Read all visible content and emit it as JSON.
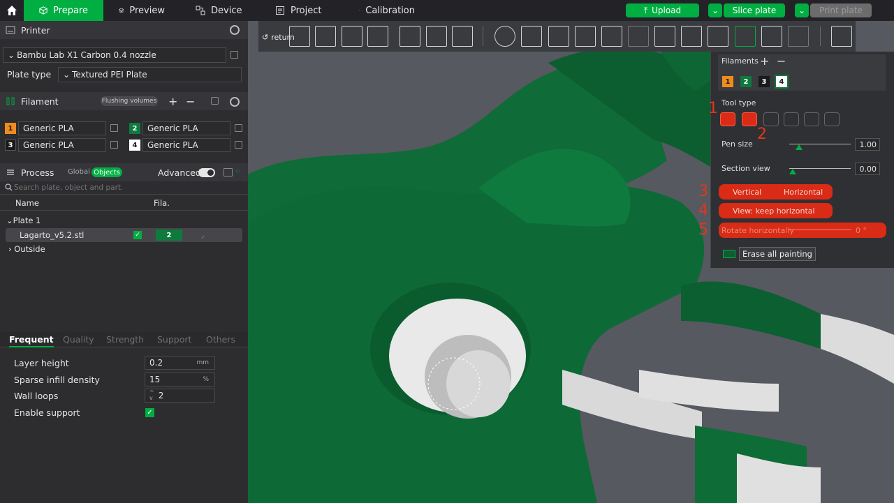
{
  "topbar": {
    "tabs": [
      {
        "label": "Prepare",
        "icon": "cube-icon"
      },
      {
        "label": "Preview",
        "icon": "layers-icon"
      },
      {
        "label": "Device",
        "icon": "device-icon"
      },
      {
        "label": "Project",
        "icon": "project-icon"
      },
      {
        "label": "Calibration",
        "icon": "calibration-icon"
      }
    ],
    "upload": "Upload",
    "slice": "Slice plate",
    "print": "Print plate"
  },
  "printer": {
    "title": "Printer",
    "name": "Bambu Lab X1 Carbon 0.4 nozzle",
    "plate_type_label": "Plate type",
    "plate_type": "Textured PEI Plate"
  },
  "filament": {
    "title": "Filament",
    "flushing": "Flushing volumes",
    "items": [
      {
        "num": "1",
        "name": "Generic PLA",
        "color": "#f08c1e"
      },
      {
        "num": "2",
        "name": "Generic PLA",
        "color": "#0e7a3e"
      },
      {
        "num": "3",
        "name": "Generic PLA",
        "color": "#1a1a1a"
      },
      {
        "num": "4",
        "name": "Generic PLA",
        "color": "#ffffff"
      }
    ]
  },
  "process": {
    "title": "Process",
    "global": "Global",
    "objects": "Objects",
    "advanced": "Advanced",
    "search_placeholder": "Search plate, object and part."
  },
  "objects": {
    "col_name": "Name",
    "col_fila": "Fila.",
    "plate": "Plate 1",
    "object": "Lagarto_v5.2.stl",
    "object_fila": "2",
    "outside": "Outside"
  },
  "tabs2": [
    "Frequent",
    "Quality",
    "Strength",
    "Support",
    "Others"
  ],
  "settings": [
    {
      "label": "Layer height",
      "value": "0.2",
      "unit": "mm"
    },
    {
      "label": "Sparse infill density",
      "value": "15",
      "unit": "%"
    },
    {
      "label": "Wall loops",
      "value": "2",
      "unit": ""
    },
    {
      "label": "Enable support",
      "value": "",
      "unit": ""
    }
  ],
  "toolbar": {
    "return": "return"
  },
  "paint": {
    "filaments": "Filaments",
    "tool_type": "Tool type",
    "pen_size": "Pen size",
    "pen_size_val": "1.00",
    "section_view": "Section view",
    "section_val": "0.00",
    "vertical": "Vertical",
    "horizontal": "Horizontal",
    "keep_horizontal": "View: keep horizontal",
    "rotate": "Rotate horizontally",
    "rotate_val": "0 °",
    "erase": "Erase all painting",
    "fil_nums": [
      "1",
      "2",
      "3",
      "4"
    ],
    "annotations": [
      "1",
      "2",
      "3",
      "4",
      "5"
    ]
  }
}
